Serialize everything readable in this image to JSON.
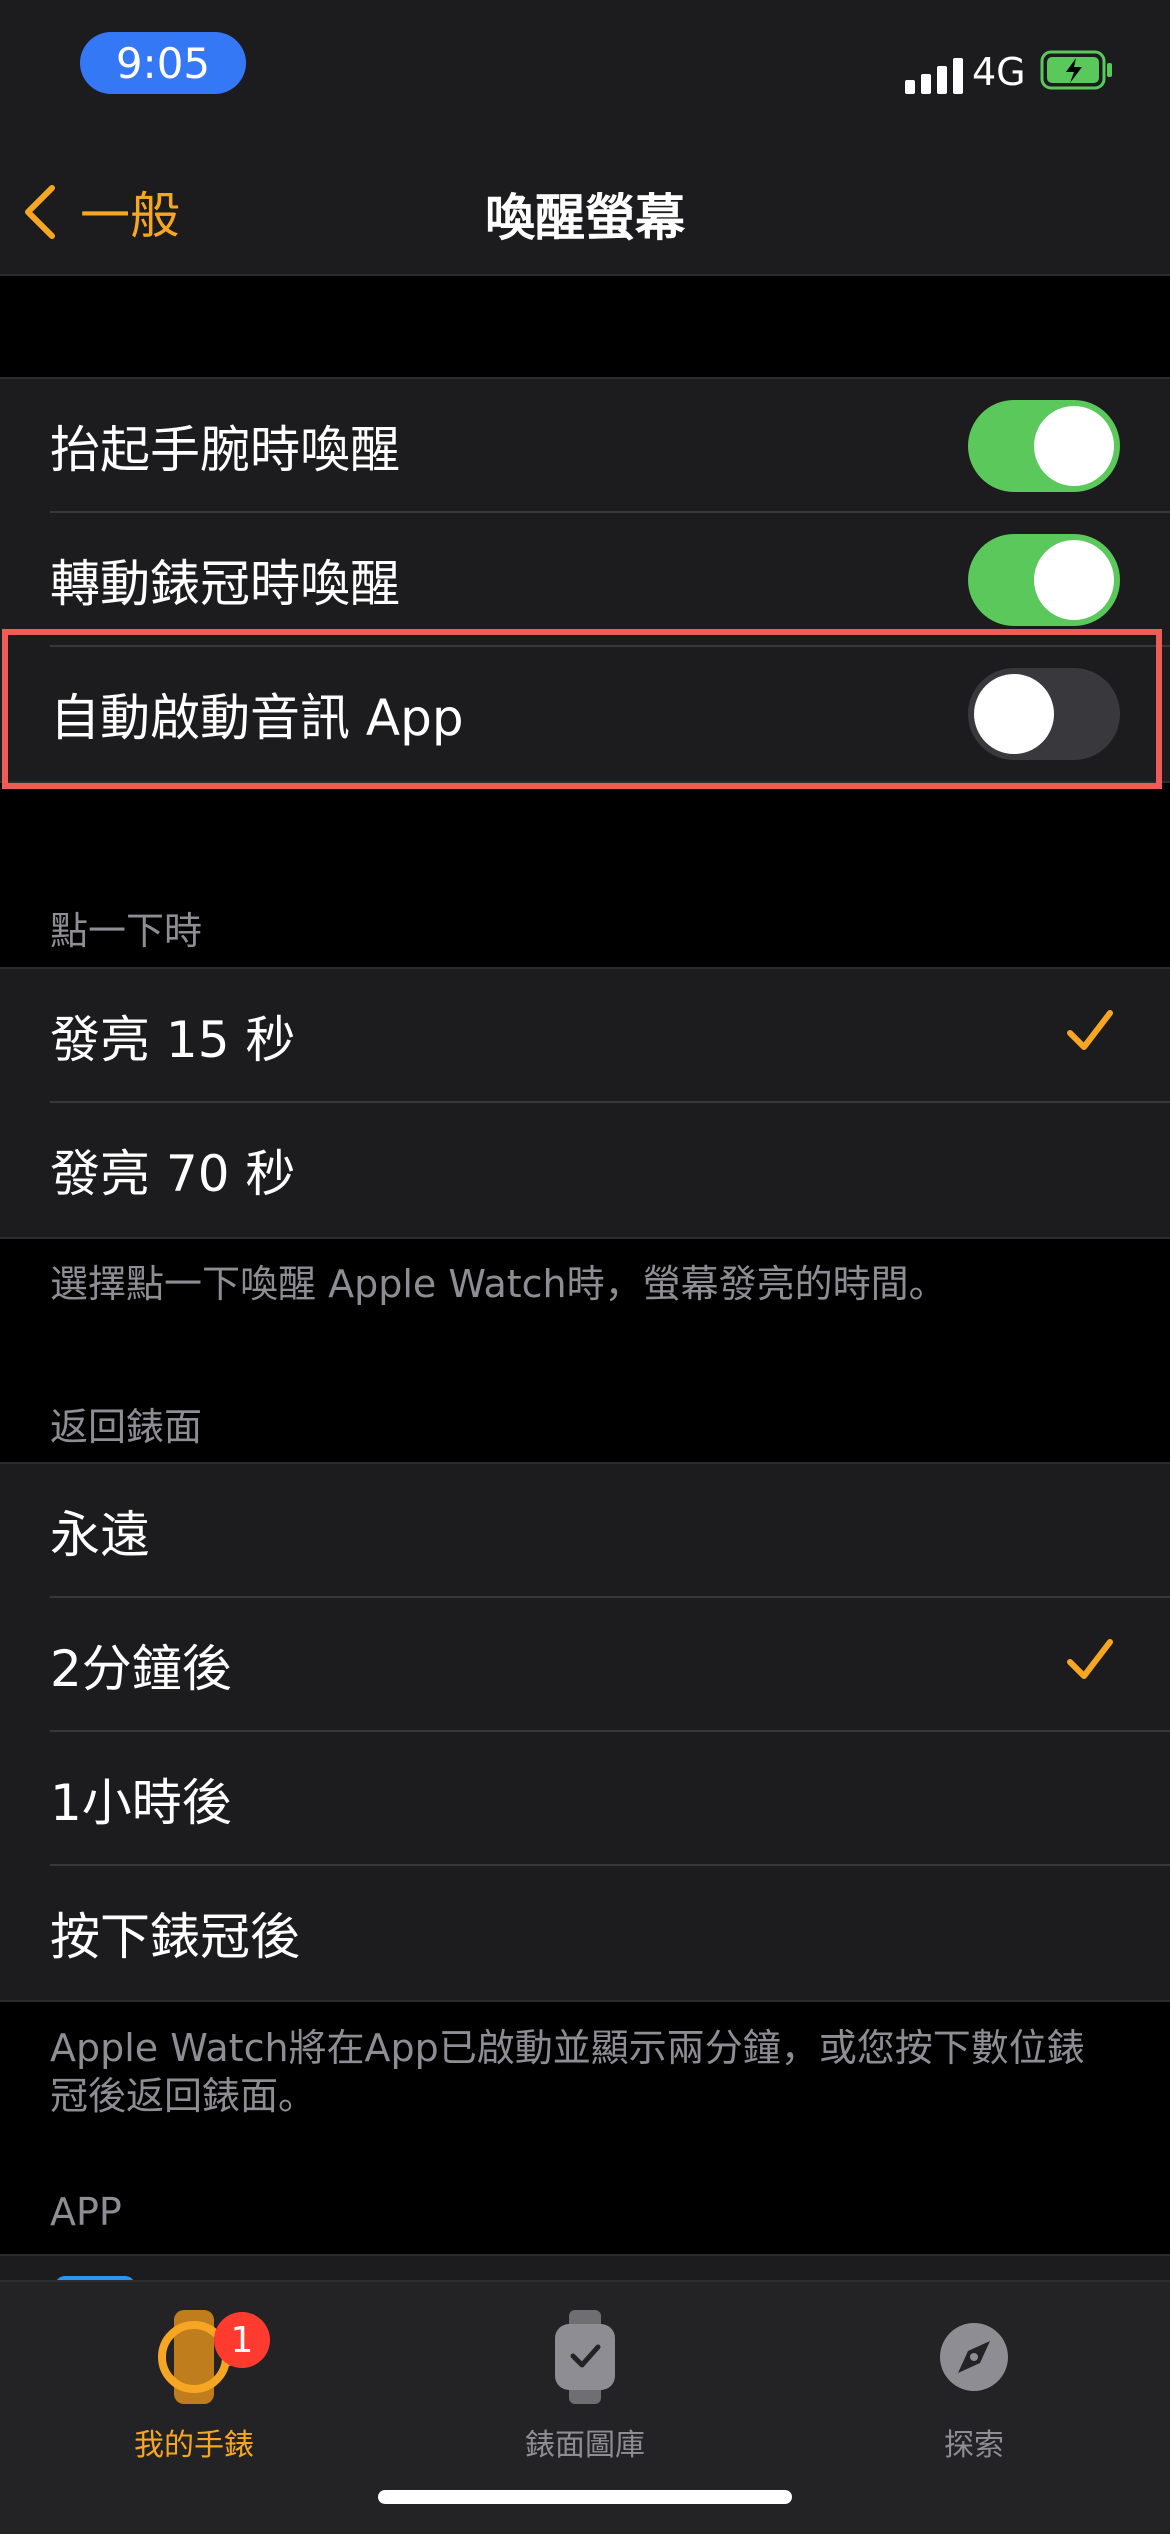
{
  "status_bar": {
    "time": "9:05",
    "network": "4G",
    "battery_color": "#5ac85a",
    "accent": "#3478f6"
  },
  "nav": {
    "back_label": "一般",
    "title": "喚醒螢幕"
  },
  "toggles": [
    {
      "label": "抬起手腕時喚醒",
      "on": true
    },
    {
      "label": "轉動錶冠時喚醒",
      "on": true
    },
    {
      "label": "自動啟動音訊 App",
      "on": false
    }
  ],
  "tap_section": {
    "header": "點一下時",
    "options": [
      {
        "label": "發亮 15 秒",
        "selected": true
      },
      {
        "label": "發亮 70 秒",
        "selected": false
      }
    ],
    "footer": "選擇點一下喚醒 Apple Watch時，螢幕發亮的時間。"
  },
  "return_section": {
    "header": "返回錶面",
    "options": [
      {
        "label": "永遠",
        "selected": false
      },
      {
        "label": "2分鐘後",
        "selected": true
      },
      {
        "label": "1小時後",
        "selected": false
      },
      {
        "label": "按下錶冠後",
        "selected": false
      }
    ],
    "footer": "Apple Watch將在App已啟動並顯示兩分鐘，或您按下數位錶冠後返回錶面。"
  },
  "app_section": {
    "header": "APP"
  },
  "tabbar": {
    "tabs": [
      {
        "label": "我的手錶",
        "icon": "watch-icon",
        "active": true,
        "badge": "1"
      },
      {
        "label": "錶面圖庫",
        "icon": "watch-face-gallery-icon",
        "active": false
      },
      {
        "label": "探索",
        "icon": "compass-icon",
        "active": false
      }
    ]
  },
  "colors": {
    "accent": "#f6a623",
    "toggle_on": "#5ac85a",
    "highlight": "#ef5b57",
    "badge": "#ff3b30"
  }
}
